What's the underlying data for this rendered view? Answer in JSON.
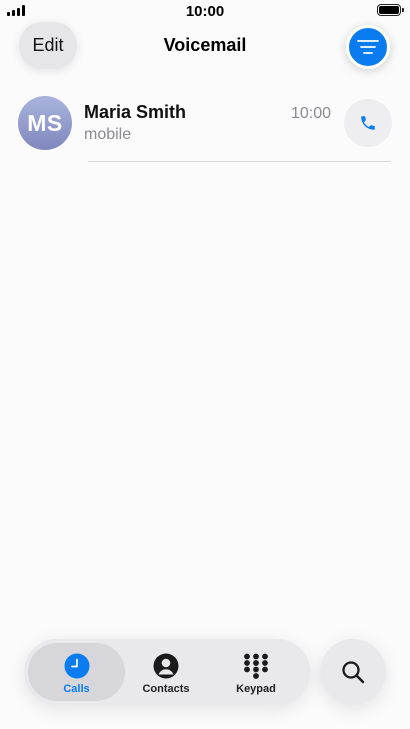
{
  "status_bar": {
    "time": "10:00",
    "signal_icon": "signal-bars-icon",
    "battery_icon": "battery-icon",
    "battery_level": 1.0
  },
  "header": {
    "edit_label": "Edit",
    "title": "Voicemail",
    "filter_icon": "filter-lines-icon"
  },
  "voicemails": [
    {
      "initials": "MS",
      "name": "Maria Smith",
      "label": "mobile",
      "time": "10:00",
      "action_icon": "phone-icon"
    }
  ],
  "tab_bar": {
    "tabs": [
      {
        "label": "Calls",
        "icon": "clock-icon",
        "active": true
      },
      {
        "label": "Contacts",
        "icon": "person-circle-icon",
        "active": false
      },
      {
        "label": "Keypad",
        "icon": "keypad-grid-icon",
        "active": false
      }
    ],
    "search_icon": "search-icon"
  },
  "colors": {
    "accent": "#0a7cf0",
    "background": "#fbfbfc",
    "secondary_text": "#8a8a8f",
    "avatar_top": "#a9b4de",
    "avatar_bottom": "#8087bd"
  }
}
